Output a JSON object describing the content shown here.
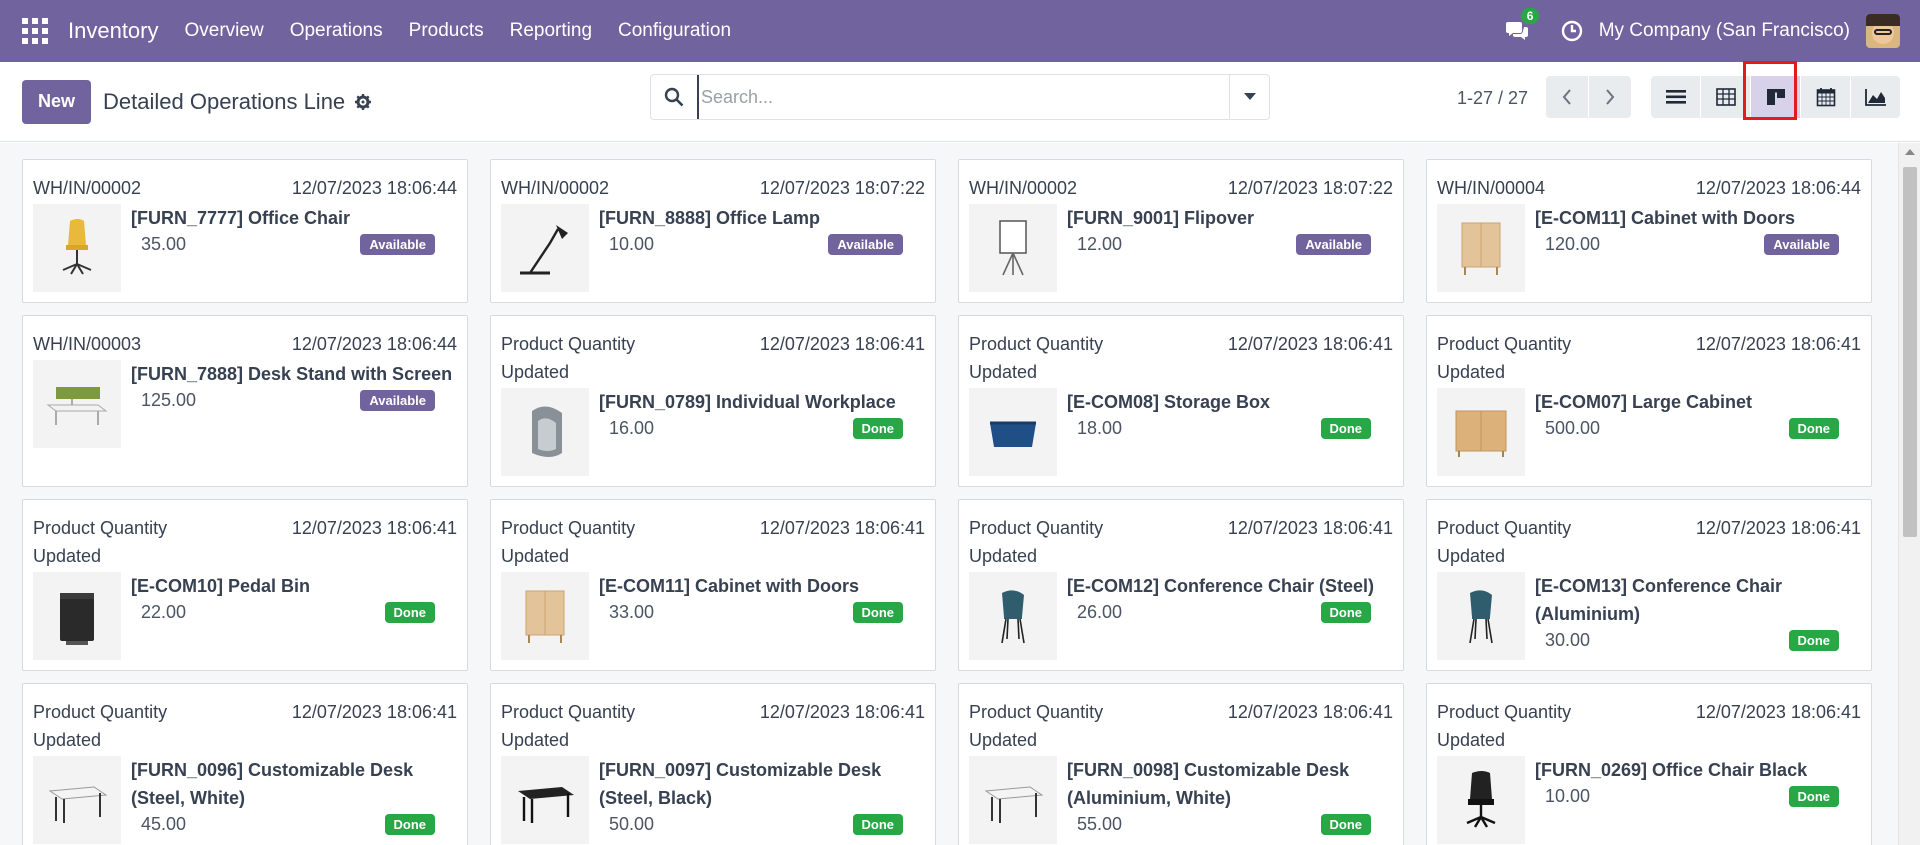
{
  "navbar": {
    "app_name": "Inventory",
    "menu": [
      "Overview",
      "Operations",
      "Products",
      "Reporting",
      "Configuration"
    ],
    "chat_count": "6",
    "company": "My Company (San Francisco)"
  },
  "control": {
    "new_label": "New",
    "title": "Detailed Operations Line",
    "search_placeholder": "Search...",
    "pager": "1-27 / 27",
    "active_view": "kanban"
  },
  "colors": {
    "brand": "#71639e",
    "done": "#28a745",
    "highlight": "#e21b1b"
  },
  "cards": [
    {
      "ref": "WH/IN/00002",
      "date": "12/07/2023 18:06:44",
      "product": "[FURN_7777] Office Chair",
      "qty": "35.00",
      "status": "Available",
      "icon": "office-chair-icon"
    },
    {
      "ref": "WH/IN/00002",
      "date": "12/07/2023 18:07:22",
      "product": "[FURN_8888] Office Lamp",
      "qty": "10.00",
      "status": "Available",
      "icon": "lamp-icon"
    },
    {
      "ref": "WH/IN/00002",
      "date": "12/07/2023 18:07:22",
      "product": "[FURN_9001] Flipover",
      "qty": "12.00",
      "status": "Available",
      "icon": "flipover-icon"
    },
    {
      "ref": "WH/IN/00004",
      "date": "12/07/2023 18:06:44",
      "product": "[E-COM11] Cabinet with Doors",
      "qty": "120.00",
      "status": "Available",
      "icon": "cabinet-icon"
    },
    {
      "ref": "WH/IN/00003",
      "date": "12/07/2023 18:06:44",
      "product": "[FURN_7888] Desk Stand with Screen",
      "qty": "125.00",
      "status": "Available",
      "icon": "desk-stand-icon"
    },
    {
      "ref": "Product Quantity Updated",
      "date": "12/07/2023 18:06:41",
      "product": "[FURN_0789] Individual Workplace",
      "qty": "16.00",
      "status": "Done",
      "icon": "workplace-icon"
    },
    {
      "ref": "Product Quantity Updated",
      "date": "12/07/2023 18:06:41",
      "product": "[E-COM08] Storage Box",
      "qty": "18.00",
      "status": "Done",
      "icon": "storage-box-icon"
    },
    {
      "ref": "Product Quantity Updated",
      "date": "12/07/2023 18:06:41",
      "product": "[E-COM07] Large Cabinet",
      "qty": "500.00",
      "status": "Done",
      "icon": "large-cabinet-icon"
    },
    {
      "ref": "Product Quantity Updated",
      "date": "12/07/2023 18:06:41",
      "product": "[E-COM10] Pedal Bin",
      "qty": "22.00",
      "status": "Done",
      "icon": "pedal-bin-icon"
    },
    {
      "ref": "Product Quantity Updated",
      "date": "12/07/2023 18:06:41",
      "product": "[E-COM11] Cabinet with Doors",
      "qty": "33.00",
      "status": "Done",
      "icon": "cabinet-icon"
    },
    {
      "ref": "Product Quantity Updated",
      "date": "12/07/2023 18:06:41",
      "product": "[E-COM12] Conference Chair (Steel)",
      "qty": "26.00",
      "status": "Done",
      "icon": "conference-chair-icon"
    },
    {
      "ref": "Product Quantity Updated",
      "date": "12/07/2023 18:06:41",
      "product": "[E-COM13] Conference Chair (Aluminium)",
      "qty": "30.00",
      "status": "Done",
      "icon": "conference-chair-icon"
    },
    {
      "ref": "Product Quantity Updated",
      "date": "12/07/2023 18:06:41",
      "product": "[FURN_0096] Customizable Desk (Steel, White)",
      "qty": "45.00",
      "status": "Done",
      "icon": "desk-white-icon"
    },
    {
      "ref": "Product Quantity Updated",
      "date": "12/07/2023 18:06:41",
      "product": "[FURN_0097] Customizable Desk (Steel, Black)",
      "qty": "50.00",
      "status": "Done",
      "icon": "desk-black-icon"
    },
    {
      "ref": "Product Quantity Updated",
      "date": "12/07/2023 18:06:41",
      "product": "[FURN_0098] Customizable Desk (Aluminium, White)",
      "qty": "55.00",
      "status": "Done",
      "icon": "desk-white-icon"
    },
    {
      "ref": "Product Quantity Updated",
      "date": "12/07/2023 18:06:41",
      "product": "[FURN_0269] Office Chair Black",
      "qty": "10.00",
      "status": "Done",
      "icon": "office-chair-black-icon"
    }
  ]
}
